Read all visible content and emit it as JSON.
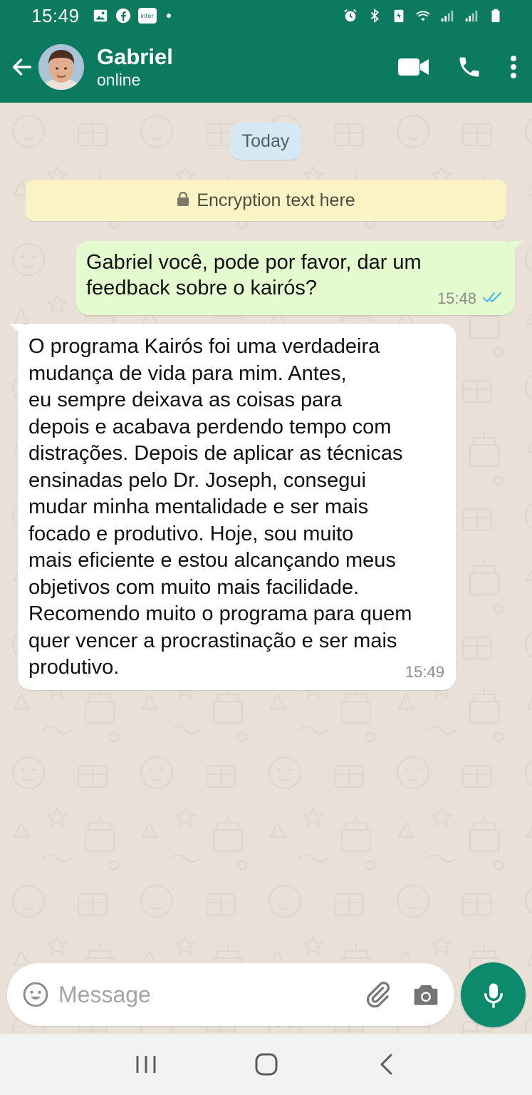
{
  "status_bar": {
    "time": "15:49",
    "left_icons": [
      "gallery-icon",
      "facebook-icon",
      "inter-app-icon",
      "dot-icon"
    ],
    "inter_label": "inter",
    "right_icons": [
      "alarm-icon",
      "bluetooth-icon",
      "battery-saver-icon",
      "wifi-icon",
      "signal-icon",
      "signal-icon-2",
      "battery-icon"
    ]
  },
  "header": {
    "contact_name": "Gabriel",
    "contact_status": "online",
    "actions": [
      "video-call-icon",
      "voice-call-icon",
      "more-options-icon"
    ]
  },
  "chat": {
    "date_chip": "Today",
    "encryption_text": "Encryption text here",
    "messages": [
      {
        "direction": "outgoing",
        "text": "Gabriel você, pode por favor, dar um\nfeedback sobre o kairós?",
        "time": "15:48",
        "status": "read"
      },
      {
        "direction": "incoming",
        "text": "O programa Kairós foi uma verdadeira\nmudança de vida para mim. Antes,\neu sempre deixava as coisas para\ndepois e acabava perdendo tempo com\ndistrações. Depois de aplicar as técnicas\nensinadas pelo Dr. Joseph, consegui\nmudar minha mentalidade e ser mais\nfocado e produtivo. Hoje, sou muito\nmais eficiente e estou alcançando meus\nobjetivos com muito mais facilidade.\nRecomendo muito o programa para quem\nquer vencer a procrastinação e ser mais\nprodutivo.",
        "time": "15:49"
      }
    ]
  },
  "composer": {
    "placeholder": "Message",
    "value": ""
  },
  "colors": {
    "header": "#0b7a5f",
    "outgoing_bubble": "#e4fbcf",
    "incoming_bubble": "#ffffff",
    "mic_button": "#0b8a6c",
    "read_ticks": "#4fb6ec",
    "chat_background": "#e9e1d8"
  }
}
